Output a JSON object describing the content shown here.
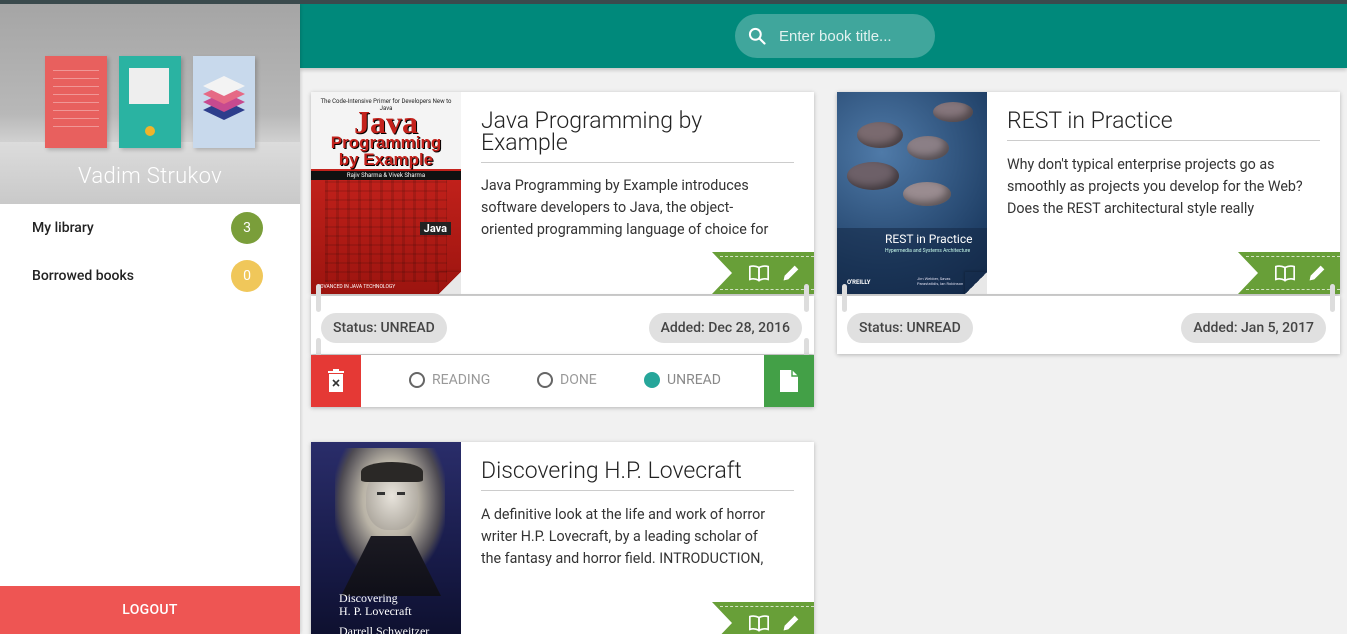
{
  "user": {
    "name": "Vadim Strukov"
  },
  "nav": [
    {
      "label": "My library",
      "count": "3",
      "badge_color": "#7a9e3a"
    },
    {
      "label": "Borrowed books",
      "count": "0",
      "badge_color": "#f0c75a"
    }
  ],
  "logout_label": "LOGOUT",
  "search": {
    "placeholder": "Enter book title..."
  },
  "books": [
    {
      "title": "Java Programming by Example",
      "description_lines": [
        "Java Programming by Example introduces",
        "software developers to Java, the object-",
        "oriented programming language of choice for"
      ],
      "status": "Status: UNREAD",
      "added": "Added: Dec 28, 2016",
      "cover": {
        "top_text": "The Code-Intensive Primer for Developers New to Java",
        "title1": "Java",
        "title2": "Programming",
        "title3": "by Example",
        "authors": "Rajiv Sharma & Vivek Sharma",
        "bottom_text": "ADVANCED IN JAVA TECHNOLOGY",
        "badge": "Java"
      }
    },
    {
      "title": "REST in Practice",
      "description_lines": [
        "Why don't typical enterprise projects go as",
        "smoothly as projects you develop for the Web?",
        "Does the REST architectural style really"
      ],
      "status": "Status: UNREAD",
      "added": "Added: Jan 5, 2017",
      "cover": {
        "title": "REST in Practice",
        "subtitle": "Hypermedia and Systems Architecture",
        "publisher": "O'REILLY",
        "authors": "Jim Webber, Savas Parastatidis, Ian Robinson"
      }
    },
    {
      "title": "Discovering H.P. Lovecraft",
      "description_lines": [
        "A definitive look at the life and work of horror",
        "writer H.P. Lovecraft, by a leading scholar of",
        "the fantasy and horror field. INTRODUCTION,"
      ],
      "cover": {
        "title1": "Discovering",
        "title2": "H. P. Lovecraft",
        "author": "Darrell Schweitzer"
      }
    }
  ],
  "status_options": [
    {
      "label": "READING",
      "checked": false
    },
    {
      "label": "DONE",
      "checked": false
    },
    {
      "label": "UNREAD",
      "checked": true
    }
  ],
  "colors": {
    "primary": "#00897b",
    "accent": "#26a69a",
    "ribbon": "#689f38",
    "delete": "#e53935",
    "save": "#43a047",
    "logout": "#ee5553"
  }
}
